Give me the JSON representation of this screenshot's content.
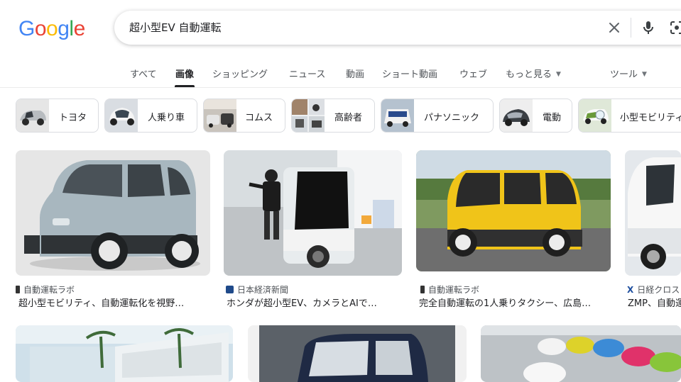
{
  "logo": {
    "letters": [
      "G",
      "o",
      "o",
      "g",
      "l",
      "e"
    ],
    "colors": [
      "#4285F4",
      "#EA4335",
      "#FBBC05",
      "#4285F4",
      "#34A853",
      "#EA4335"
    ]
  },
  "search": {
    "query": "超小型EV 自動運転"
  },
  "tabs": [
    {
      "label": "すべて"
    },
    {
      "label": "画像"
    },
    {
      "label": "ショッピング"
    },
    {
      "label": "ニュース"
    },
    {
      "label": "動画"
    },
    {
      "label": "ショート動画"
    },
    {
      "label": "ウェブ"
    },
    {
      "label": "もっと見る"
    },
    {
      "label": "ツール"
    }
  ],
  "chips": [
    {
      "label": "トヨタ"
    },
    {
      "label": "人乗り車"
    },
    {
      "label": "コムス"
    },
    {
      "label": "高齢者"
    },
    {
      "label": "パナソニック"
    },
    {
      "label": "電動"
    },
    {
      "label": "小型モビリティ"
    }
  ],
  "results": [
    {
      "source": "自動運転ラボ",
      "title": "超小型モビリティ、自動運転化を視野…"
    },
    {
      "source": "日本経済新聞",
      "title": "ホンダが超小型EV、カメラとAIで…"
    },
    {
      "source": "自動運転ラボ",
      "title": "完全自動運転の1人乗りタクシー、広島…"
    },
    {
      "source": "日経クロス",
      "title": "ZMP、自動運"
    }
  ],
  "colors": {
    "accent": "#1a73e8",
    "text": "#202124",
    "subtext": "#4d5156"
  }
}
